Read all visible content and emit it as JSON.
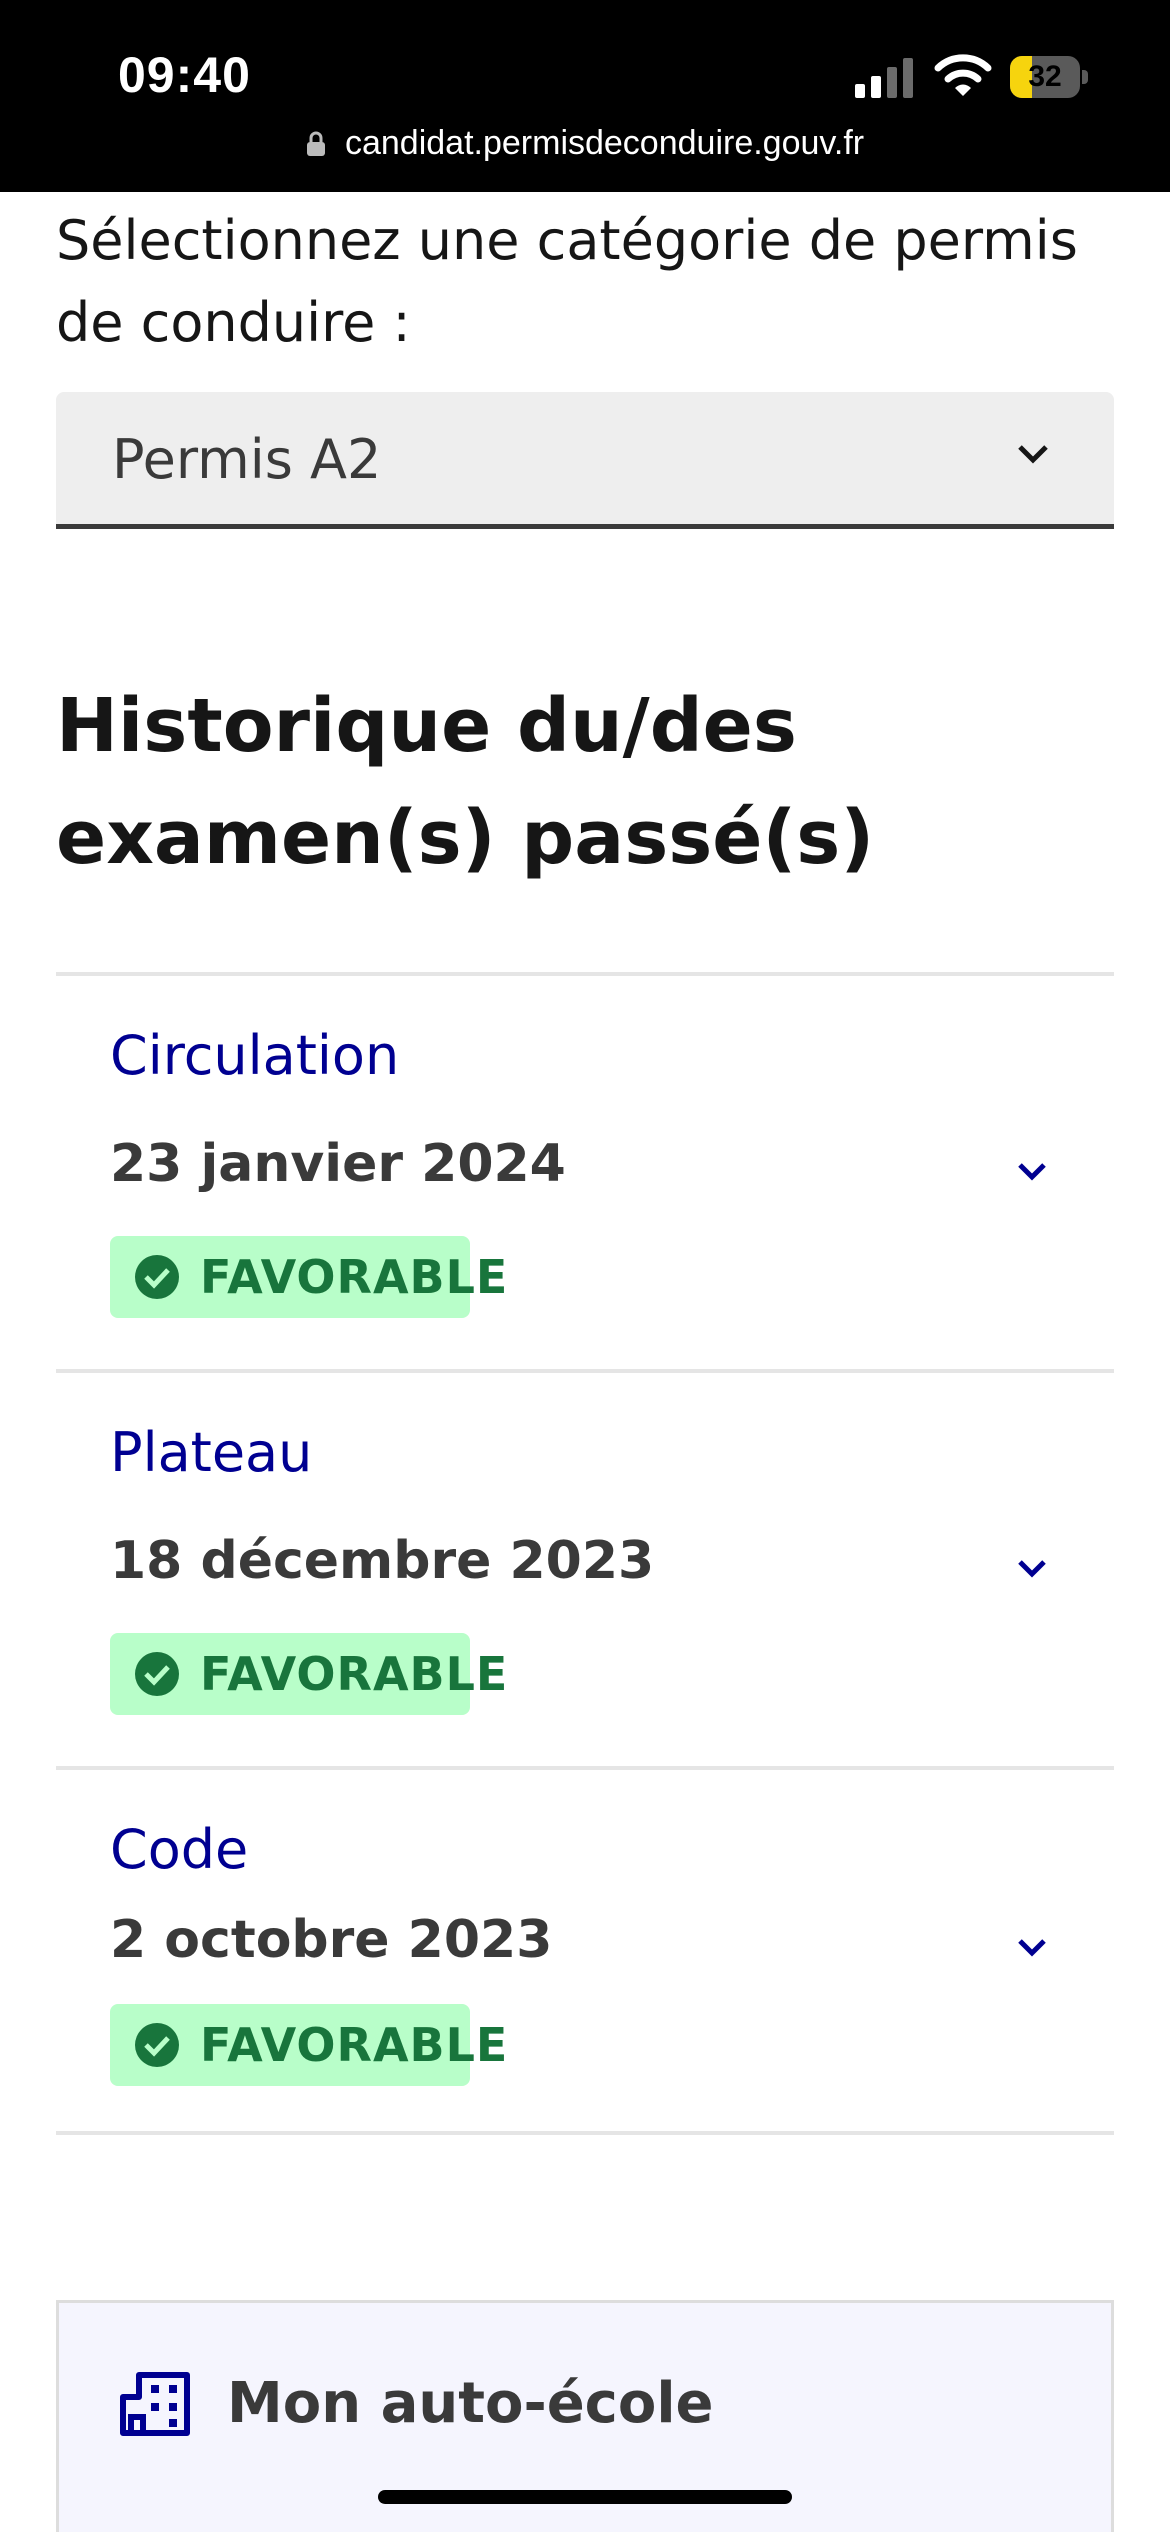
{
  "status_bar": {
    "time": "09:40",
    "battery_level": "32",
    "battery_fraction": 0.32,
    "battery_fill_color": "#f6d40e",
    "url": "candidat.permisdeconduire.gouv.fr",
    "icons": [
      "signal-icon",
      "wifi-icon",
      "battery-icon",
      "lock-icon"
    ]
  },
  "category_select": {
    "label": "Sélectionnez une catégorie de permis de conduire :",
    "selected_value": "Permis A2"
  },
  "history": {
    "title": "Historique du/des examen(s) passé(s)",
    "exams": [
      {
        "type": "Circulation",
        "date": "23 janvier 2024",
        "result": "FAVORABLE"
      },
      {
        "type": "Plateau",
        "date": "18 décembre 2023",
        "result": "FAVORABLE"
      },
      {
        "type": "Code",
        "date": "2 octobre 2023",
        "result": "FAVORABLE"
      }
    ]
  },
  "auto_ecole": {
    "title": "Mon auto-école"
  },
  "colors": {
    "accent_blue": "#000091",
    "success_text": "#18753c",
    "success_bg": "#b8fec9"
  }
}
